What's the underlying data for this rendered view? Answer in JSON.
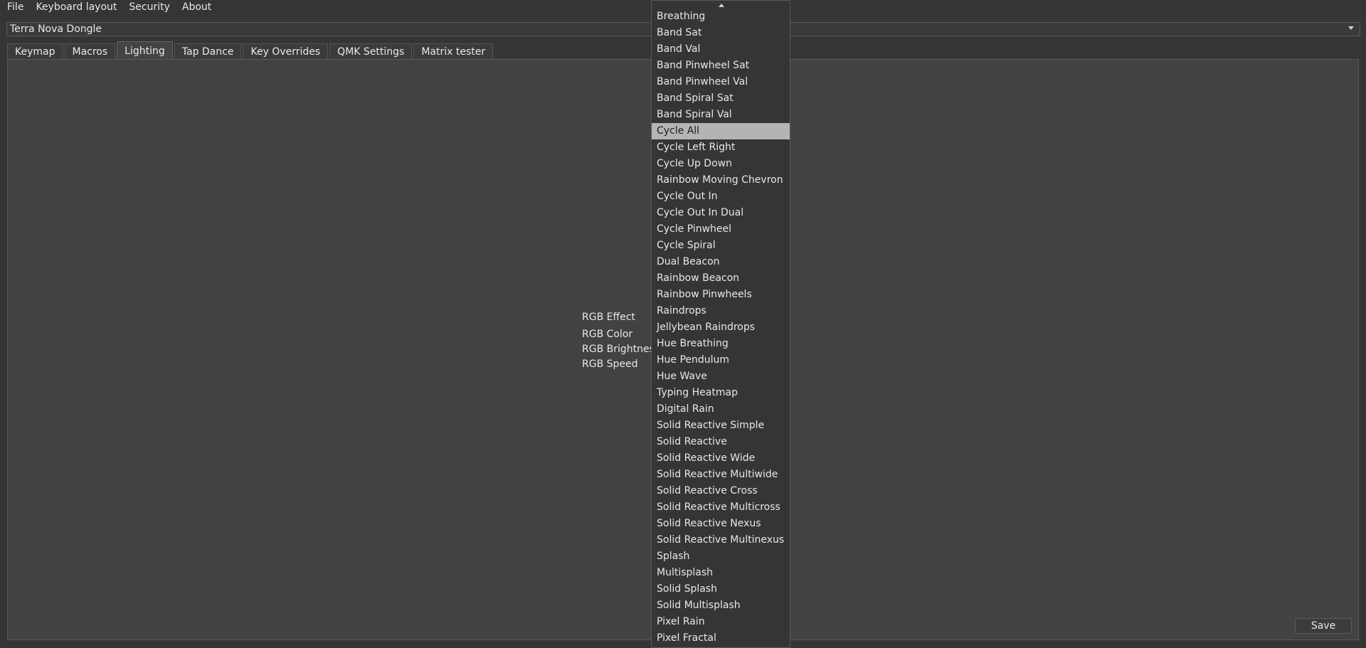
{
  "menubar": {
    "items": [
      "File",
      "Keyboard layout",
      "Security",
      "About"
    ]
  },
  "device_select": {
    "value": "Terra Nova Dongle"
  },
  "tabs": [
    {
      "label": "Keymap"
    },
    {
      "label": "Macros"
    },
    {
      "label": "Lighting",
      "active": true
    },
    {
      "label": "Tap Dance"
    },
    {
      "label": "Key Overrides"
    },
    {
      "label": "QMK Settings"
    },
    {
      "label": "Matrix tester"
    }
  ],
  "lighting": {
    "rgb_effect_label": "RGB Effect",
    "rgb_color_label": "RGB Color",
    "rgb_brightness_label": "RGB Brightness",
    "rgb_speed_label": "RGB Speed"
  },
  "save_label": "Save",
  "effect_dropdown": {
    "selected": "Cycle All",
    "options": [
      "Breathing",
      "Band Sat",
      "Band Val",
      "Band Pinwheel Sat",
      "Band Pinwheel Val",
      "Band Spiral Sat",
      "Band Spiral Val",
      "Cycle All",
      "Cycle Left Right",
      "Cycle Up Down",
      "Rainbow Moving Chevron",
      "Cycle Out In",
      "Cycle Out In Dual",
      "Cycle Pinwheel",
      "Cycle Spiral",
      "Dual Beacon",
      "Rainbow Beacon",
      "Rainbow Pinwheels",
      "Raindrops",
      "Jellybean Raindrops",
      "Hue Breathing",
      "Hue Pendulum",
      "Hue Wave",
      "Typing Heatmap",
      "Digital Rain",
      "Solid Reactive Simple",
      "Solid Reactive",
      "Solid Reactive Wide",
      "Solid Reactive Multiwide",
      "Solid Reactive Cross",
      "Solid Reactive Multicross",
      "Solid Reactive Nexus",
      "Solid Reactive Multinexus",
      "Splash",
      "Multisplash",
      "Solid Splash",
      "Solid Multisplash",
      "Pixel Rain",
      "Pixel Fractal"
    ]
  },
  "colors": {
    "background": "#353535",
    "panel": "#424242",
    "highlight": "#b4b4b4"
  }
}
